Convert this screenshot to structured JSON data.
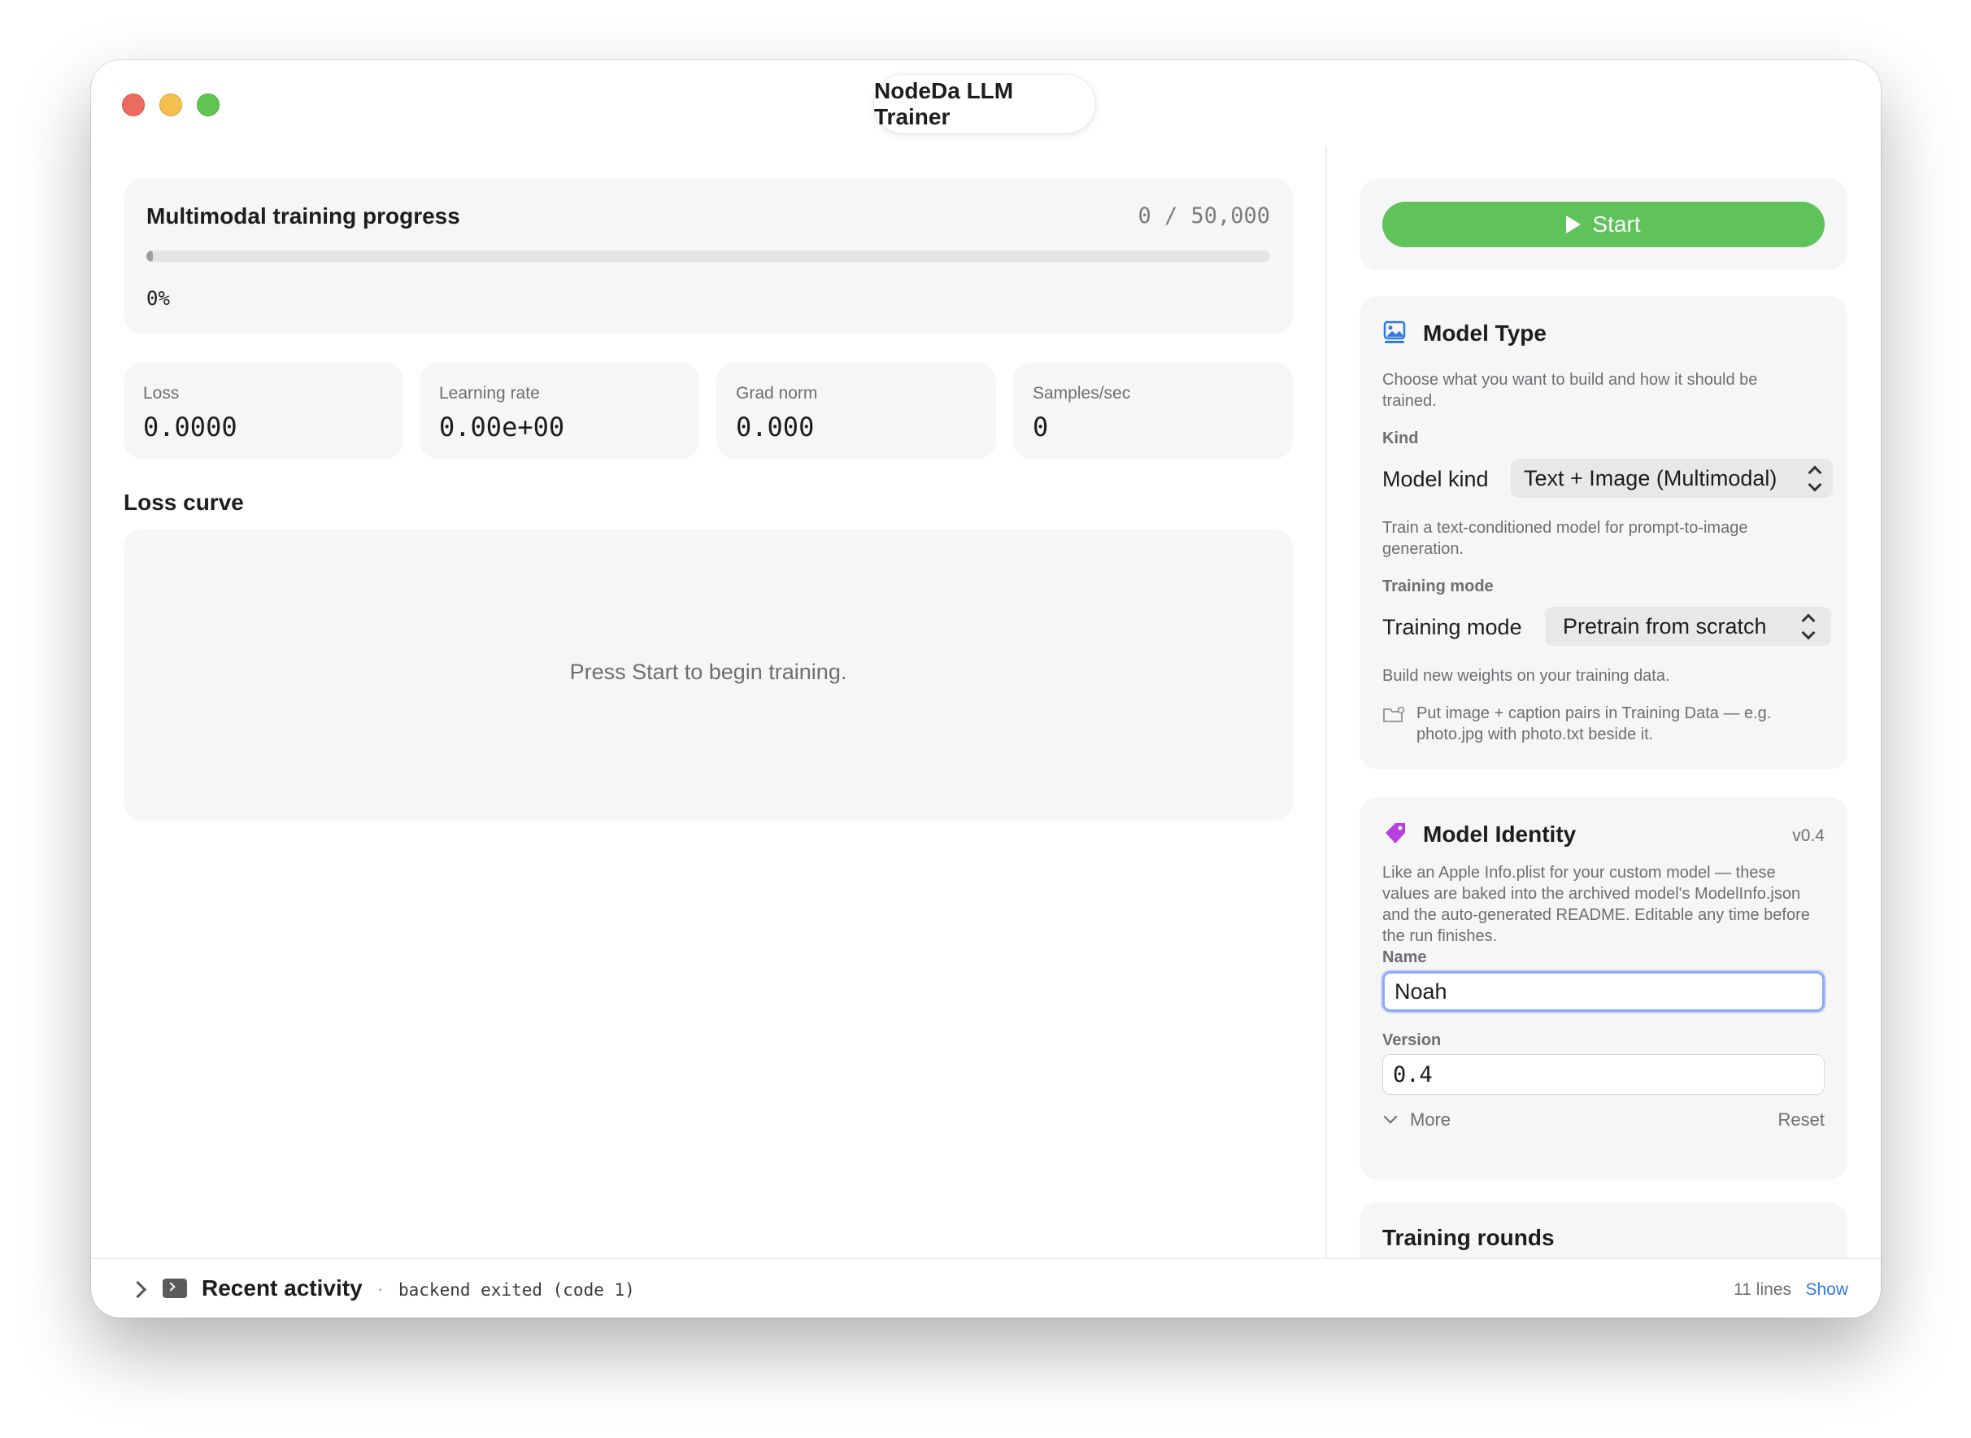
{
  "window": {
    "title": "NodeDa LLM Trainer"
  },
  "progress": {
    "title": "Multimodal training progress",
    "count": "0 / 50,000",
    "percent_text": "0%",
    "fraction": 0
  },
  "metrics": [
    {
      "label": "Loss",
      "value": "0.0000"
    },
    {
      "label": "Learning rate",
      "value": "0.00e+00"
    },
    {
      "label": "Grad norm",
      "value": "0.000"
    },
    {
      "label": "Samples/sec",
      "value": "0"
    }
  ],
  "loss_curve": {
    "title": "Loss curve",
    "empty_message": "Press Start to begin training."
  },
  "start": {
    "label": "Start",
    "color": "#5fc25b"
  },
  "model_type": {
    "title": "Model Type",
    "icon": "image-icon",
    "description": "Choose what you want to build and how it should be trained.",
    "kind_section": "Kind",
    "kind_label": "Model kind",
    "kind_value": "Text + Image (Multimodal)",
    "kind_help": "Train a text-conditioned model for prompt-to-image generation.",
    "mode_section": "Training mode",
    "mode_label": "Training mode",
    "mode_value": "Pretrain from scratch",
    "mode_help": "Build new weights on your training data.",
    "data_hint": "Put image + caption pairs in Training Data — e.g. photo.jpg with photo.txt beside it.",
    "data_hint_icon": "folder-icon"
  },
  "model_identity": {
    "title": "Model Identity",
    "icon": "tag-icon",
    "version_tag": "v0.4",
    "description": "Like an Apple Info.plist for your custom model — these values are baked into the archived model's ModelInfo.json and the auto-generated README. Editable any time before the run finishes.",
    "name_label": "Name",
    "name_value": "Noah",
    "version_label": "Version",
    "version_value": "0.4",
    "more_label": "More",
    "reset_label": "Reset"
  },
  "training_rounds": {
    "title": "Training rounds"
  },
  "activity": {
    "title": "Recent activity",
    "separator": "·",
    "status": "backend exited (code 1)",
    "lines": "11 lines",
    "show_label": "Show"
  },
  "colors": {
    "accent": "#2f7ae5",
    "start": "#5fc25b",
    "tag": "#b73fe0",
    "focus": "#8eaaf5"
  }
}
